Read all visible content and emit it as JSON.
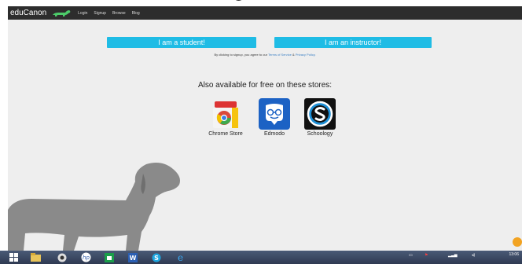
{
  "navbar": {
    "brand": "eduCanon",
    "links": [
      "Login",
      "Signup",
      "Browse",
      "Blog"
    ]
  },
  "signup": {
    "student_label": "I am a student!",
    "instructor_label": "I am an instructor!",
    "terms_prefix": "By clicking to signup, you agree to our",
    "terms_link": "Terms of Service",
    "terms_and": "&",
    "privacy_link": "Privacy Policy."
  },
  "stores": {
    "title": "Also available for free on these stores:",
    "items": [
      {
        "label": "Chrome Store",
        "icon": "chrome-store-icon"
      },
      {
        "label": "Edmodo",
        "icon": "edmodo-icon"
      },
      {
        "label": "Schoology",
        "icon": "schoology-icon"
      }
    ]
  },
  "taskbar": {
    "apps": [
      "start-icon",
      "file-explorer-icon",
      "browser-icon",
      "hp-icon",
      "store-icon",
      "word-icon",
      "skype-icon",
      "internet-explorer-icon"
    ],
    "clock_time": "13:06"
  },
  "colors": {
    "accent": "#1fbce5",
    "navbar": "#2d2d2d",
    "page": "#eeeeee",
    "dog": "#8a8a8a"
  }
}
